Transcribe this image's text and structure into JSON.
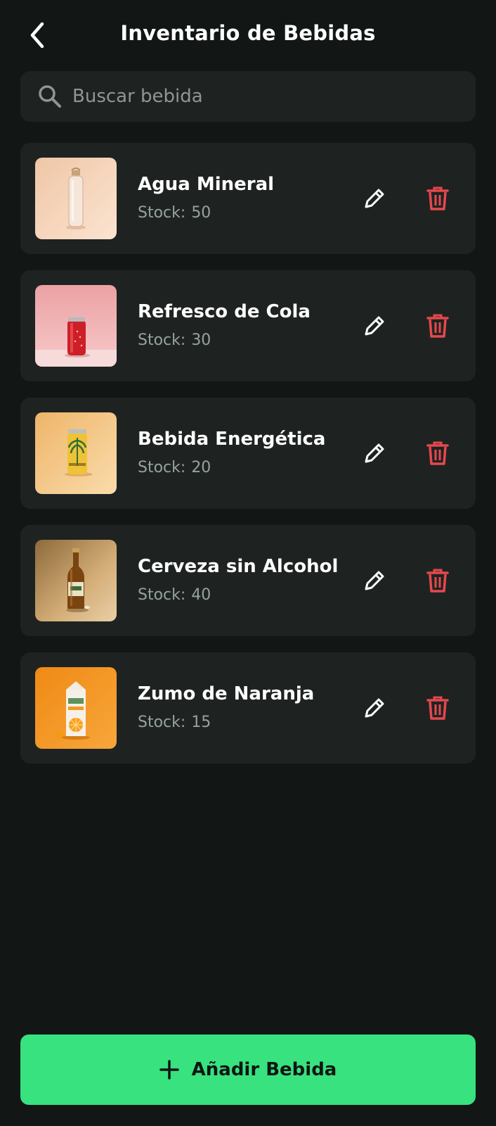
{
  "header": {
    "title": "Inventario de Bebidas"
  },
  "search": {
    "placeholder": "Buscar bebida",
    "value": ""
  },
  "items": [
    {
      "name": "Agua Mineral",
      "stock_label": "Stock:",
      "stock": "50",
      "image": "water-bottle"
    },
    {
      "name": "Refresco de Cola",
      "stock_label": "Stock:",
      "stock": "30",
      "image": "cola-can"
    },
    {
      "name": "Bebida Energética",
      "stock_label": "Stock:",
      "stock": "20",
      "image": "energy-drink-can"
    },
    {
      "name": "Cerveza sin Alcohol",
      "stock_label": "Stock:",
      "stock": "40",
      "image": "beer-bottle"
    },
    {
      "name": "Zumo de Naranja",
      "stock_label": "Stock:",
      "stock": "15",
      "image": "orange-juice-carton"
    }
  ],
  "footer": {
    "add_label": "Añadir Bebida"
  },
  "colors": {
    "background": "#121716",
    "card": "#1e2322",
    "accent": "#37e27f",
    "delete": "#e5484d",
    "stock_text": "#96a29f"
  },
  "icons": {
    "back": "chevron-left-icon",
    "search": "search-icon",
    "edit": "pencil-icon",
    "delete": "trash-icon",
    "add": "plus-icon"
  }
}
